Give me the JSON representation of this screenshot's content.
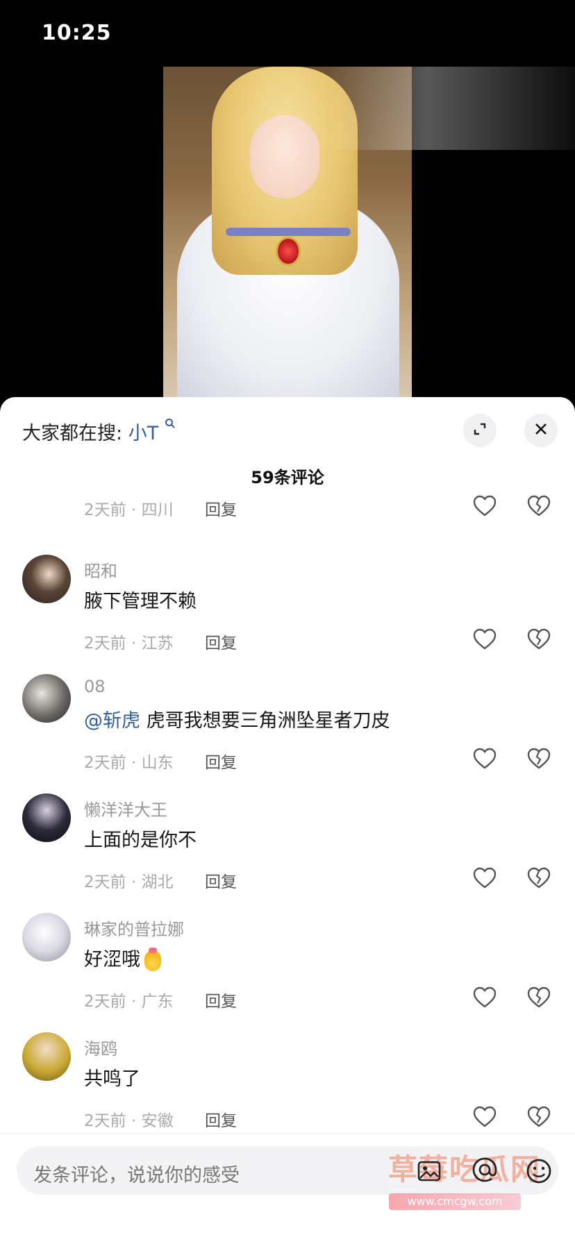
{
  "status_bar": {
    "time": "10:25"
  },
  "panel": {
    "search_prefix": "大家都在搜:",
    "search_keyword": "小T",
    "comment_count_label": "59条评论"
  },
  "comments": [
    {
      "user": "",
      "text": "",
      "time_location": "2天前 · 四川",
      "reply_label": "回复"
    },
    {
      "user": "昭和",
      "text": "腋下管理不赖",
      "time_location": "2天前 · 江苏",
      "reply_label": "回复"
    },
    {
      "user": "08",
      "mention": "@斩虎",
      "text": "虎哥我想要三角洲坠星者刀皮",
      "time_location": "2天前 · 山东",
      "reply_label": "回复"
    },
    {
      "user": "懒洋洋大王",
      "text": "上面的是你不",
      "time_location": "2天前 · 湖北",
      "reply_label": "回复"
    },
    {
      "user": "琳家的普拉娜",
      "text": "好涩哦",
      "time_location": "2天前 · 广东",
      "reply_label": "回复"
    },
    {
      "user": "海鸥",
      "text": "共鸣了",
      "time_location": "2天前 · 安徽",
      "reply_label": "回复"
    }
  ],
  "input_bar": {
    "placeholder": "发条评论，说说你的感受",
    "watermark_text": "草莓吃瓜网",
    "watermark_url": "www.cmcgw.com"
  },
  "icons": {
    "search": "search-icon",
    "expand": "expand-icon",
    "close": "close-icon",
    "like": "heart-icon",
    "dislike": "broken-heart-icon",
    "image": "image-icon",
    "at": "at-icon",
    "emoji": "emoji-icon"
  },
  "colors": {
    "link": "#2f5f9e",
    "sheet": "#ffffff",
    "background": "#000000"
  }
}
